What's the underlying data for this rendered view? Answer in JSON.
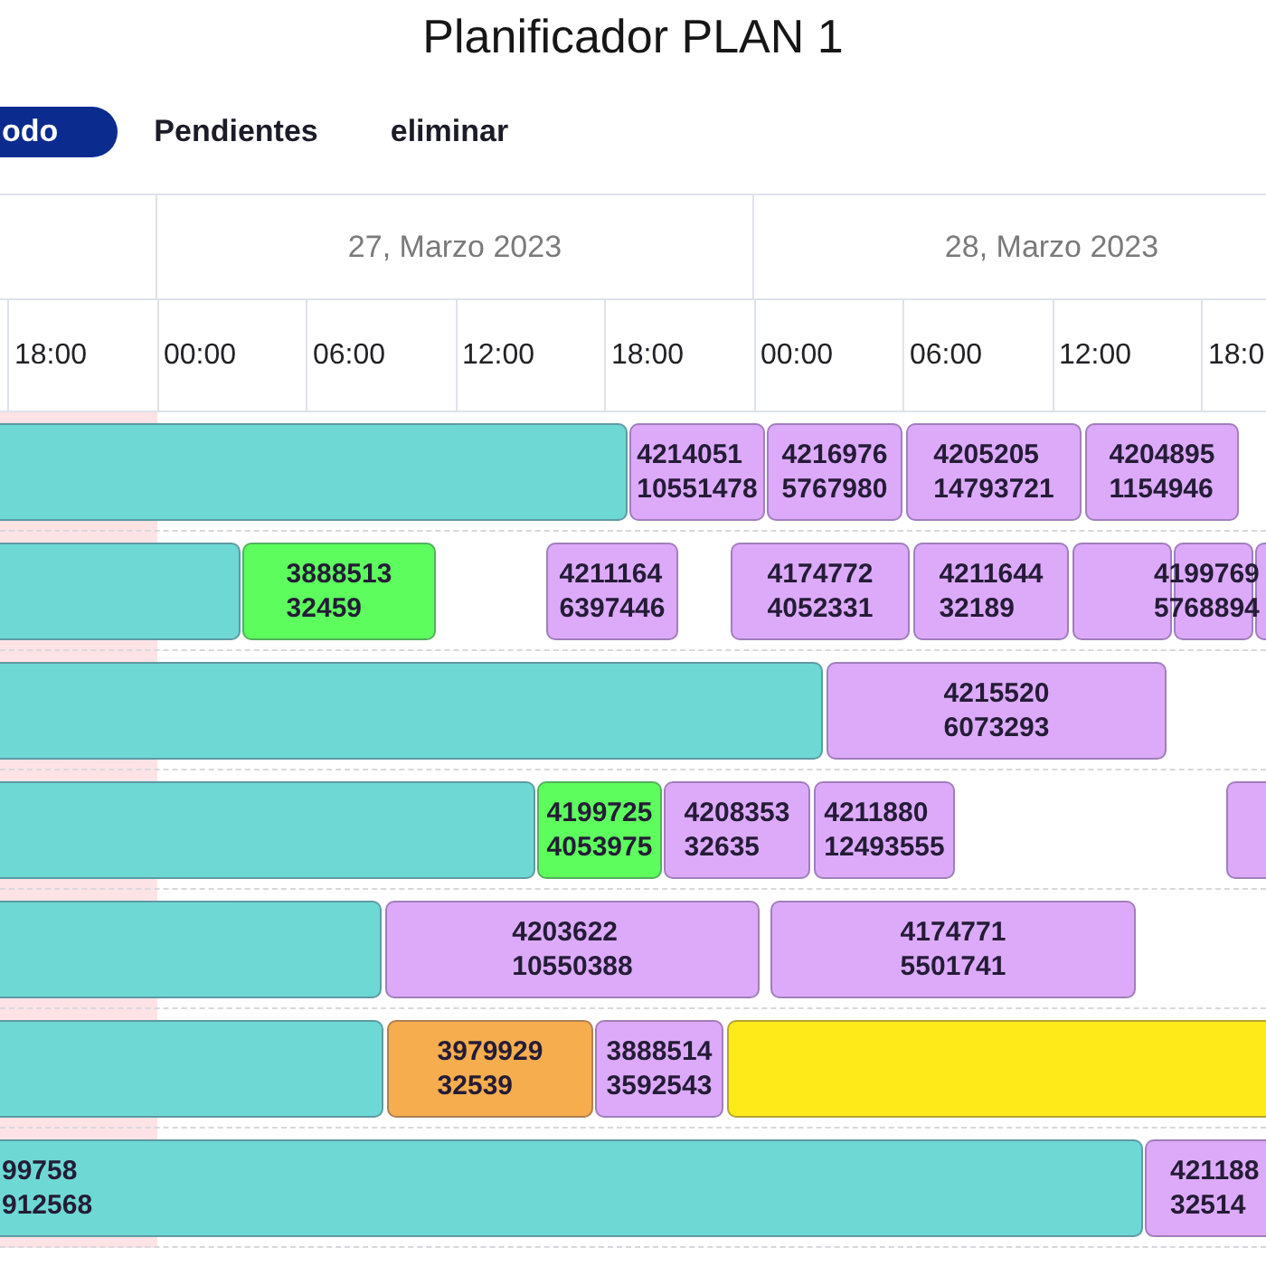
{
  "title": "Planificador PLAN 1",
  "tabs": [
    {
      "label": "odo",
      "selected": true
    },
    {
      "label": "Pendientes",
      "selected": false
    },
    {
      "label": "eliminar",
      "selected": false
    }
  ],
  "timeline": {
    "dates": [
      "27, Marzo 2023",
      "28, Marzo 2023"
    ],
    "hours": [
      "18:00",
      "00:00",
      "06:00",
      "12:00",
      "18:00",
      "00:00",
      "06:00",
      "12:00",
      "18:0"
    ]
  },
  "rows": [
    {
      "bars": [
        {
          "color": "#6ed9d4"
        },
        {
          "color": "#ddaafa",
          "lines": [
            "4214051",
            "10551478"
          ]
        },
        {
          "color": "#ddaafa",
          "lines": [
            "4216976",
            "5767980"
          ]
        },
        {
          "color": "#ddaafa",
          "lines": [
            "4205205",
            "14793721"
          ]
        },
        {
          "color": "#ddaafa",
          "lines": [
            "4204895",
            "1154946"
          ]
        }
      ]
    },
    {
      "bars": [
        {
          "color": "#6ed9d4"
        },
        {
          "color": "#5dfd5d",
          "lines": [
            "3888513",
            "32459"
          ]
        },
        {
          "color": "#ddaafa",
          "lines": [
            "4211164",
            "6397446"
          ]
        },
        {
          "color": "#ddaafa",
          "lines": [
            "4174772",
            "4052331"
          ]
        },
        {
          "color": "#ddaafa",
          "lines": [
            "4211644",
            "32189"
          ]
        },
        {
          "color": "#ddaafa"
        },
        {
          "color": "#ddaafa",
          "lines": [
            "4199769",
            "5768894"
          ]
        },
        {
          "color": "#ddaafa"
        }
      ]
    },
    {
      "bars": [
        {
          "color": "#6ed9d4"
        },
        {
          "color": "#ddaafa",
          "lines": [
            "4215520",
            "6073293"
          ]
        }
      ]
    },
    {
      "bars": [
        {
          "color": "#6ed9d4"
        },
        {
          "color": "#5dfd5d",
          "lines": [
            "4199725",
            "4053975"
          ]
        },
        {
          "color": "#ddaafa",
          "lines": [
            "4208353",
            "32635"
          ]
        },
        {
          "color": "#ddaafa",
          "lines": [
            "4211880",
            "12493555"
          ]
        },
        {
          "color": "#ddaafa"
        }
      ]
    },
    {
      "bars": [
        {
          "color": "#6ed9d4"
        },
        {
          "color": "#ddaafa",
          "lines": [
            "4203622",
            "10550388"
          ]
        },
        {
          "color": "#ddaafa",
          "lines": [
            "4174771",
            "5501741"
          ]
        }
      ]
    },
    {
      "bars": [
        {
          "color": "#6ed9d4"
        },
        {
          "color": "#f5ad4e",
          "lines": [
            "3979929",
            "32539"
          ]
        },
        {
          "color": "#ddaafa",
          "lines": [
            "3888514",
            "3592543"
          ]
        },
        {
          "color": "#ffea19"
        }
      ]
    },
    {
      "bars": [
        {
          "color": "#6ed9d4",
          "lines": [
            "99758",
            "912568"
          ]
        },
        {
          "color": "#ddaafa",
          "lines": [
            "421188",
            "32514"
          ]
        }
      ]
    }
  ]
}
